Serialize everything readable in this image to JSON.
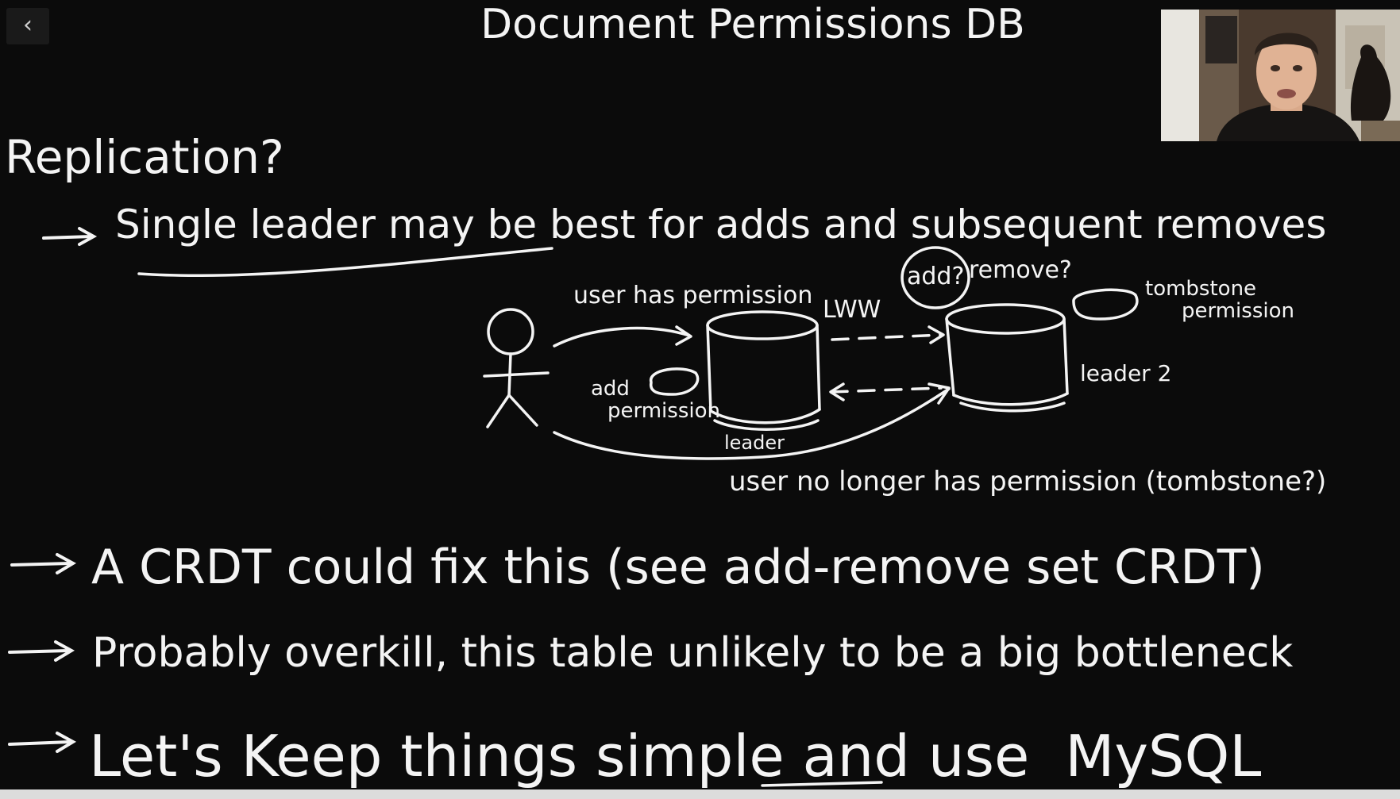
{
  "ui": {
    "back_glyph": "‹"
  },
  "whiteboard": {
    "title": "Document Permissions DB",
    "heading": "Replication?",
    "bullet1": "Single leader may be best for adds and subsequent removes",
    "diagram": {
      "arrow_top": "user has permission",
      "lww": "LWW",
      "add_q": "add?",
      "remove_q": "remove?",
      "tombstone_permission": [
        "tombstone",
        "permission"
      ],
      "leader2": "leader 2",
      "add_permission": [
        "add",
        "permission"
      ],
      "leader": "leader",
      "arrow_bottom": "user no longer has permission (tombstone?)"
    },
    "bullet2": "A CRDT could fix this (see add-remove set CRDT)",
    "bullet3": "Probably overkill, this table unlikely to be a big bottleneck",
    "bullet4_prefix": "Let's Keep things simple and use",
    "bullet4_emph": "MySQL"
  },
  "colors": {
    "board": "#0b0b0b",
    "ink": "#f4f4f4"
  }
}
